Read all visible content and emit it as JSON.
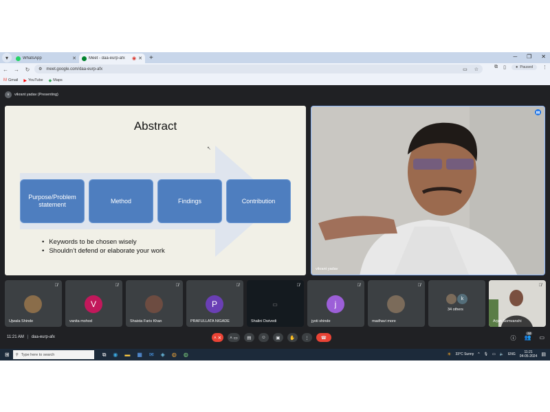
{
  "browser": {
    "tabs": [
      {
        "title": "WhatsApp",
        "favicon_color": "#25d366"
      },
      {
        "title": "Meet - daa-eurp-afx",
        "favicon_color": "#00832d"
      }
    ],
    "url": "meet.google.com/daa-eurp-afx",
    "profile_label": "Paused",
    "bookmarks": [
      {
        "label": "Gmail",
        "color": "#ea4335"
      },
      {
        "label": "YouTube",
        "color": "#ff0000"
      },
      {
        "label": "Maps",
        "color": "#34a853"
      }
    ]
  },
  "meet": {
    "presenter_initial": "v",
    "presenter_label": "vikrant yadav (Presenting)",
    "slide": {
      "title": "Abstract",
      "boxes": [
        "Purpose/Problem statement",
        "Method",
        "Findings",
        "Contribution"
      ],
      "bullets": [
        "Keywords to be chosen wisely",
        "Shouldn’t defend or elaborate your work"
      ]
    },
    "speaker_name": "vikrant yadav",
    "participants": [
      {
        "name": "Ujwala Shinde",
        "initial": "",
        "color": "#8a6d4a"
      },
      {
        "name": "vanita mohod",
        "initial": "V",
        "color": "#c2185b"
      },
      {
        "name": "Shaista Faris Khan",
        "initial": "",
        "color": "#6d4c41"
      },
      {
        "name": "PRAFULLATA NIGADE",
        "initial": "P",
        "color": "#6a3fb5"
      },
      {
        "name": "Shalini Dwivedi",
        "initial": "",
        "color": "#263238"
      },
      {
        "name": "jyoti shinde",
        "initial": "j",
        "color": "#9c5fd8"
      },
      {
        "name": "madhavi more",
        "initial": "",
        "color": "#7b6b5a"
      },
      {
        "name": "34 others",
        "initial": "k",
        "color": "#546e7a"
      },
      {
        "name": "Arjun Somvanshi",
        "initial": "",
        "color": "#cfd8dc"
      }
    ],
    "time": "11:21 AM",
    "meeting_code": "daa-eurp-afx",
    "people_count": "44"
  },
  "taskbar": {
    "search_placeholder": "Type here to search",
    "weather": "33°C  Sunny",
    "lang": "ENG",
    "clock_time": "11:21",
    "clock_date": "04-05-2024"
  }
}
